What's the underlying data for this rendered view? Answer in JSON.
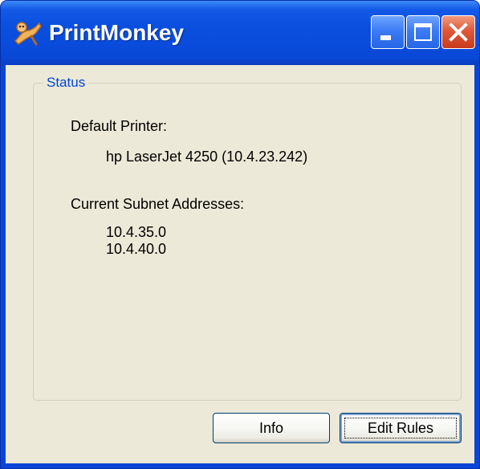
{
  "window": {
    "title": "PrintMonkey",
    "icon": "monkey-app-icon",
    "controls": {
      "minimize": "minimize-icon",
      "maximize": "maximize-icon",
      "close": "close-icon"
    }
  },
  "status": {
    "group_label": "Status",
    "default_printer_label": "Default Printer:",
    "default_printer_value": "hp LaserJet 4250 (10.4.23.242)",
    "subnets_label": "Current Subnet Addresses:",
    "subnets": [
      "10.4.35.0",
      "10.4.40.0"
    ]
  },
  "buttons": {
    "info": "Info",
    "edit_rules": "Edit Rules"
  },
  "colors": {
    "titlebar": "#0a4fde",
    "client_background": "#ece9d8",
    "group_label": "#0046d5",
    "close_button": "#e0583a"
  }
}
